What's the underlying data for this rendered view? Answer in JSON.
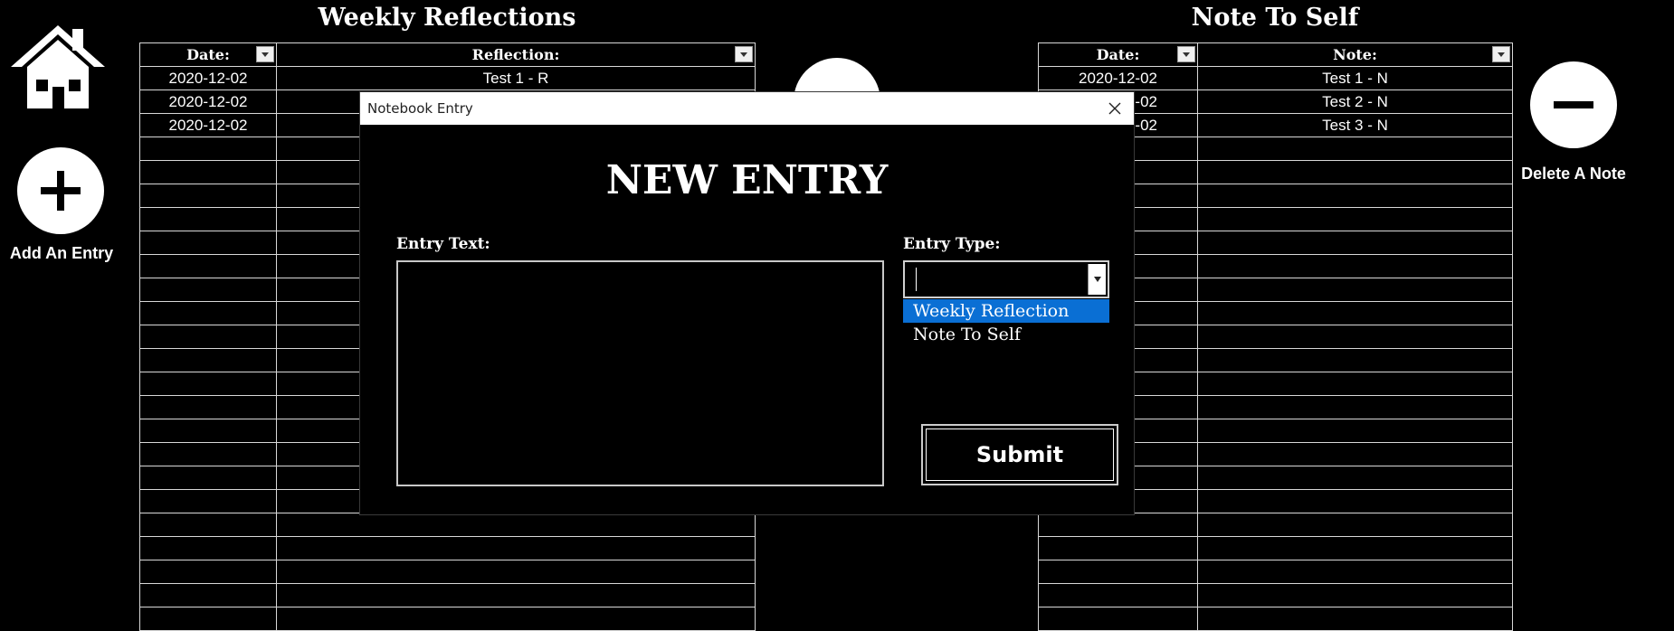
{
  "left_panel": {
    "add_label": "Add An Entry"
  },
  "right_panel": {
    "delete_label": "Delete A Note"
  },
  "reflections": {
    "title": "Weekly Reflections",
    "col_date": "Date:",
    "col_reflection": "Reflection:",
    "rows": [
      {
        "date": "2020-12-02",
        "text": "Test 1 - R"
      },
      {
        "date": "2020-12-02",
        "text": ""
      },
      {
        "date": "2020-12-02",
        "text": ""
      }
    ]
  },
  "notes": {
    "title": "Note To Self",
    "col_date": "Date:",
    "col_note": "Note:",
    "rows": [
      {
        "date": "2020-12-02",
        "text": "Test 1 - N"
      },
      {
        "date": "2020-12-02",
        "text": "Test 2 - N"
      },
      {
        "date": "2020-12-02",
        "text": "Test 3 - N"
      }
    ]
  },
  "dialog": {
    "window_title": "Notebook Entry",
    "heading": "NEW ENTRY",
    "entry_text_label": "Entry Text:",
    "entry_type_label": "Entry Type:",
    "entry_text_value": "",
    "entry_type_value": "",
    "options": [
      "Weekly Reflection",
      "Note To Self"
    ],
    "highlighted_option": "Weekly Reflection",
    "submit_label": "Submit"
  }
}
